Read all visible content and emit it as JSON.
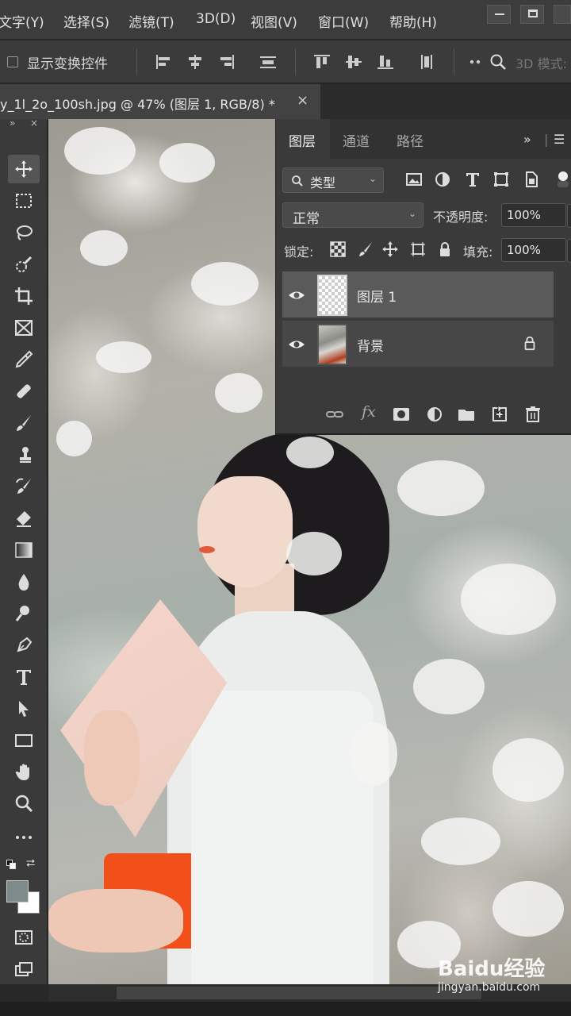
{
  "menubar": {
    "items": [
      "文字(Y)",
      "选择(S)",
      "滤镜(T)",
      "3D(D)",
      "视图(V)",
      "窗口(W)",
      "帮助(H)"
    ]
  },
  "options": {
    "show_transform_controls": "显示变换控件",
    "mode_3d": "3D 模式:"
  },
  "document": {
    "tab_title": "y_1l_2o_100sh.jpg @ 47% (图层 1, RGB/8) *",
    "close": "×"
  },
  "layers_panel": {
    "tabs": [
      "图层",
      "通道",
      "路径"
    ],
    "filter_label": "类型",
    "blend_mode": "正常",
    "opacity_label": "不透明度:",
    "opacity_value": "100%",
    "lock_label": "锁定:",
    "fill_label": "填充:",
    "fill_value": "100%",
    "layers": [
      {
        "name": "图层 1",
        "selected": true,
        "locked": false
      },
      {
        "name": "背景",
        "selected": false,
        "locked": true
      }
    ],
    "footer_fx": "fx"
  },
  "watermark": {
    "logo": "Baidu经验",
    "url": "jingyan.baidu.com"
  },
  "toolbar": {
    "header_expand": "»",
    "header_close": "×"
  },
  "colors": {
    "foreground": "#7f8b8b",
    "background": "#ffffff"
  }
}
